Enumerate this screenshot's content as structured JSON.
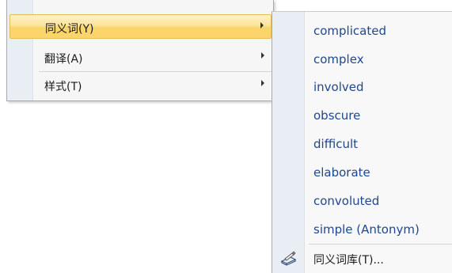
{
  "context_menu": {
    "items": [
      {
        "label": "同义词(Y)",
        "highlighted": true,
        "has_submenu": true
      },
      {
        "label": "翻译(A)",
        "highlighted": false,
        "has_submenu": true
      },
      {
        "label": "样式(T)",
        "highlighted": false,
        "has_submenu": true
      }
    ]
  },
  "synonyms_submenu": {
    "items": [
      "complicated",
      "complex",
      "involved",
      "obscure",
      "difficult",
      "elaborate",
      "convoluted",
      "simple (Antonym)"
    ],
    "thesaurus_label": "同义词库(T)...",
    "thesaurus_icon": "thesaurus-book-icon"
  },
  "colors": {
    "highlight_gradient_top": "#fef2c8",
    "highlight_gradient_bottom": "#fbd46c",
    "synonym_text": "#1f4690",
    "menu_background": "#f6f6f6",
    "gutter": "#e9eef5"
  }
}
